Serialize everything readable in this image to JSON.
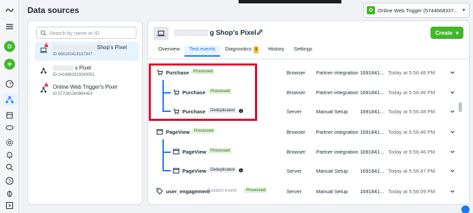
{
  "page": {
    "title": "Data sources"
  },
  "account": {
    "icon_letter": "O",
    "label": "Online Web Trigger (5744668337..."
  },
  "sidebar": {
    "avatar_letter": "O"
  },
  "search": {
    "placeholder": "Search by name or ID"
  },
  "sources": [
    {
      "name": "Shop's Pixel",
      "id": "ID 668160418197847",
      "active": true,
      "warning": true
    },
    {
      "name": "s Pixel",
      "id": "ID 1414862919280051",
      "active": false,
      "warning": false
    },
    {
      "name": "Online Web Trigger's Pixel",
      "id": "ID 577281260994453",
      "active": false,
      "warning": true
    }
  ],
  "pixel": {
    "title": "g Shop's Pixel"
  },
  "create": {
    "label": "Create"
  },
  "tabs": [
    {
      "label": "Overview"
    },
    {
      "label": "Test events",
      "active": true
    },
    {
      "label": "Diagnostics",
      "badge": "4"
    },
    {
      "label": "History"
    },
    {
      "label": "Settings"
    }
  ],
  "events": [
    {
      "name": "Purchase",
      "status": "Processed",
      "type": "ok",
      "source": "Browser",
      "setup": "Partner integration",
      "id": "1691841...",
      "time": "Today at 5:56:46 PM",
      "level": 0,
      "icon": "cart-icon"
    },
    {
      "name": "Purchase",
      "status": "Processed",
      "type": "ok",
      "source": "Browser",
      "setup": "Partner integration",
      "id": "1691841...",
      "time": "Today at 5:56:46 PM",
      "level": 1,
      "icon": "cart-icon"
    },
    {
      "name": "Purchase",
      "status": "Deduplicated",
      "type": "dup",
      "source": "Server",
      "setup": "Manual Setup",
      "id": "1691841...",
      "time": "Today at 5:56:48 PM",
      "level": 1,
      "icon": "cart-icon"
    },
    {
      "name": "PageView",
      "status": "Processed",
      "type": "ok",
      "source": "Browser",
      "setup": "Partner integration",
      "id": "1691841...",
      "time": "Today at 5:56:46 PM",
      "level": 0,
      "icon": "page-icon"
    },
    {
      "name": "PageView",
      "status": "Processed",
      "type": "ok",
      "source": "Browser",
      "setup": "Partner integration",
      "id": "1691841...",
      "time": "Today at 5:56:46 PM",
      "level": 1,
      "icon": "page-icon"
    },
    {
      "name": "PageView",
      "status": "Deduplicated",
      "type": "dup",
      "source": "Server",
      "setup": "Manual Setup",
      "id": "1691841...",
      "time": "Today at 5:56:47 PM",
      "level": 1,
      "icon": "page-icon"
    },
    {
      "name": "user_engagement",
      "custom": "Custom event",
      "status": "Processed",
      "type": "ok",
      "source": "Server",
      "setup": "Manual Setup",
      "id": "1691841...",
      "time": "Today at 5:56:09 PM",
      "level": 0,
      "icon": "tag-icon"
    }
  ]
}
